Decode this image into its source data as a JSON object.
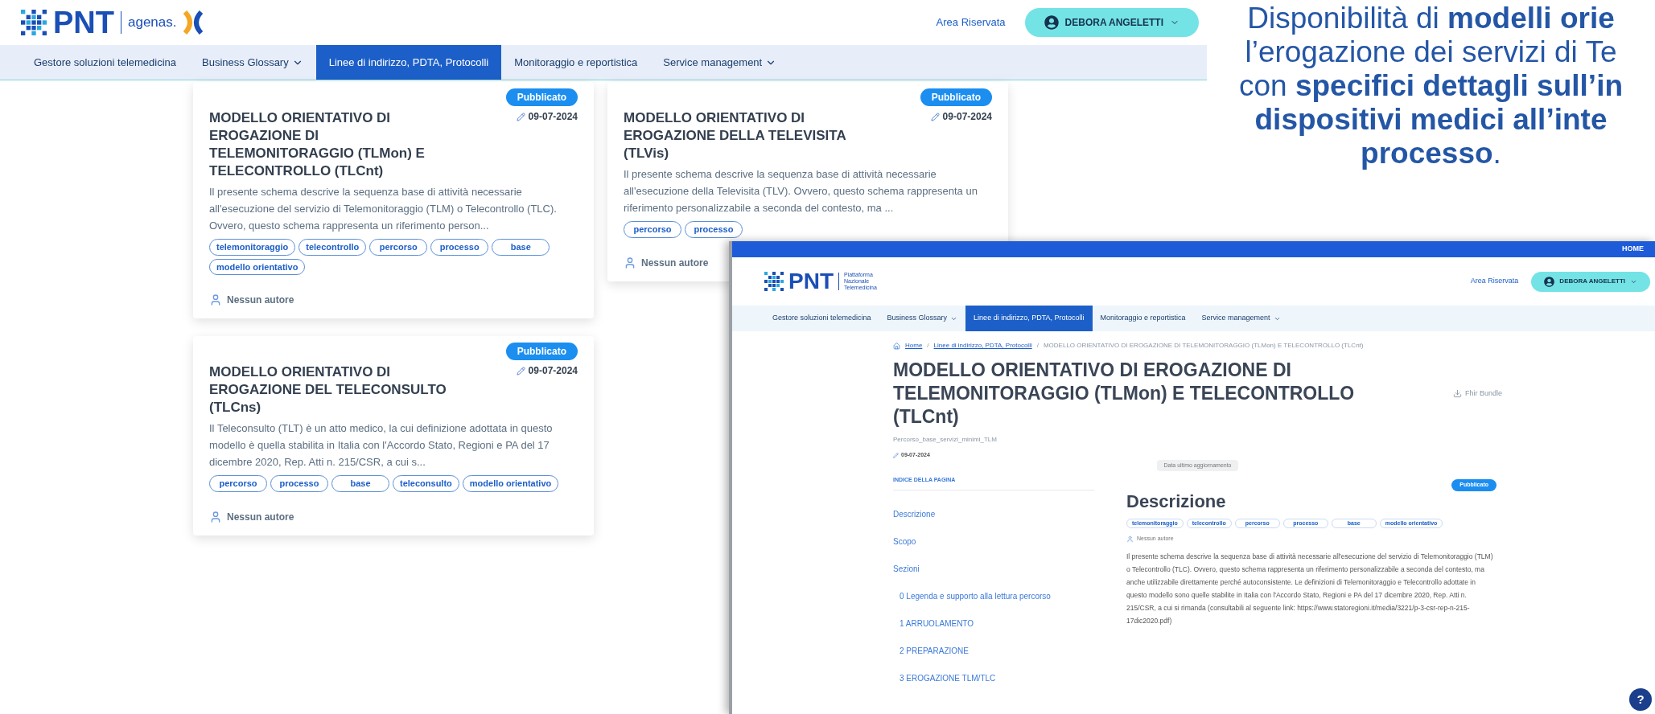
{
  "header": {
    "logo": "PNT",
    "partner": "agenas.",
    "reserved_link": "Area Riservata",
    "user": "DEBORA ANGELETTI"
  },
  "nav": [
    {
      "label": "Gestore soluzioni telemedicina",
      "selected": false,
      "has_menu": false
    },
    {
      "label": "Business Glossary",
      "selected": false,
      "has_menu": true
    },
    {
      "label": "Linee di indirizzo, PDTA, Protocolli",
      "selected": true,
      "has_menu": false
    },
    {
      "label": "Monitoraggio e reportistica",
      "selected": false,
      "has_menu": false
    },
    {
      "label": "Service management",
      "selected": false,
      "has_menu": true
    }
  ],
  "cards": [
    {
      "status": "Pubblicato",
      "date": "09-07-2024",
      "title": "MODELLO ORIENTATIVO DI EROGAZIONE DI TELEMONITORAGGIO (TLMon) E TELECONTROLLO (TLCnt)",
      "description": "Il presente schema descrive la sequenza base di attività necessarie all'esecuzione del servizio di Telemonitoraggio (TLM) o Telecontrollo (TLC). Ovvero, questo schema rappresenta un riferimento person...",
      "tags": [
        "telemonitoraggio",
        "telecontrollo",
        "percorso",
        "processo",
        "base",
        "modello orientativo"
      ],
      "author": "Nessun autore"
    },
    {
      "status": "Pubblicato",
      "date": "09-07-2024",
      "title": "MODELLO ORIENTATIVO DI EROGAZIONE DELLA TELEVISITA (TLVis)",
      "description": "Il presente schema descrive la sequenza base di attività necessarie all'esecuzione della Televisita (TLV). Ovvero, questo schema rappresenta un riferimento personalizzabile a seconda del contesto, ma ...",
      "tags": [
        "percorso",
        "processo"
      ],
      "author": "Nessun autore"
    },
    {
      "status": "Pubblicato",
      "date": "09-07-2024",
      "title": "MODELLO ORIENTATIVO DI EROGAZIONE DEL TELECONSULTO (TLCns)",
      "description": "Il Teleconsulto (TLT) è un atto medico, la cui definizione adottata in questo modello è quella stabilita in Italia con l'Accordo Stato, Regioni e PA del 17 dicembre 2020, Rep. Atti n. 215/CSR, a cui s...",
      "tags": [
        "percorso",
        "processo",
        "base",
        "teleconsulto",
        "modello orientativo"
      ],
      "author": "Nessun autore"
    }
  ],
  "slide_text": "Disponibilità di **modelli orie**\nl’erogazione dei servizi di Te\ncon **specifici dettagli sull’in**\n**dispositivi medici all’inte**\n**processo**.",
  "inset": {
    "top_bar_link": "HOME",
    "header": {
      "logo": "PNT",
      "logo_caption": "Piattaforma Nazionale Telemedicina",
      "reserved_link": "Area Riservata",
      "user": "DEBORA ANGELETTI"
    },
    "nav": [
      {
        "label": "Gestore soluzioni telemedicina",
        "selected": false,
        "has_menu": false
      },
      {
        "label": "Business Glossary",
        "selected": false,
        "has_menu": true
      },
      {
        "label": "Linee di indirizzo, PDTA, Protocolli",
        "selected": true,
        "has_menu": false
      },
      {
        "label": "Monitoraggio e reportistica",
        "selected": false,
        "has_menu": false
      },
      {
        "label": "Service management",
        "selected": false,
        "has_menu": true
      }
    ],
    "breadcrumb_separator": "/",
    "breadcrumb": [
      {
        "label": "Home",
        "kind": "home"
      },
      {
        "label": "Linee di indirizzo, PDTA, Protocolli",
        "kind": "link"
      },
      {
        "label": "MODELLO ORIENTATIVO DI EROGAZIONE DI TELEMONITORAGGIO (TLMon) E TELECONTROLLO (TLCnt)",
        "kind": "current"
      }
    ],
    "title": "MODELLO ORIENTATIVO DI EROGAZIONE DI TELEMONITORAGGIO (TLMon) E TELECONTROLLO (TLCnt)",
    "download": "Fhir Bundle",
    "subtitle": "Percorso_base_servizi_minimi_TLM",
    "date": "09-07-2024",
    "updated_label": "Data ultimo aggiornamento",
    "index_title": "INDICE DELLA PAGINA",
    "index": [
      {
        "label": "Descrizione"
      },
      {
        "label": "Scopo"
      },
      {
        "label": "Sezioni",
        "children": [
          {
            "label": "0 Legenda e supporto alla lettura percorso"
          },
          {
            "label": "1 ARRUOLAMENTO"
          },
          {
            "label": "2 PREPARAZIONE"
          },
          {
            "label": "3 EROGAZIONE TLM/TLC"
          }
        ]
      }
    ],
    "status": "Pubblicato",
    "section_title": "Descrizione",
    "tags": [
      "telemonitoraggio",
      "telecontrollo",
      "percorso",
      "processo",
      "base",
      "modello orientativo"
    ],
    "author": "Nessun autore",
    "paragraph": "Il presente schema descrive la sequenza base di attività necessarie all'esecuzione del servizio di Telemonitoraggio (TLM) o Telecontrollo (TLC). Ovvero, questo schema rappresenta un riferimento personalizzabile a seconda del contesto, ma anche utilizzabile direttamente perché autoconsistente. Le definizioni di Telemonitoraggio e Telecontrollo adottate in questo modello sono quelle stabilite in Italia con l'Accordo Stato, Regioni e PA del 17 dicembre 2020, Rep. Atti n. 215/CSR, a cui si rimanda (consultabili al seguente link: https://www.statoregioni.it/media/3221/p-3-csr-rep-n-215-17dic2020.pdf)",
    "help": "?"
  }
}
